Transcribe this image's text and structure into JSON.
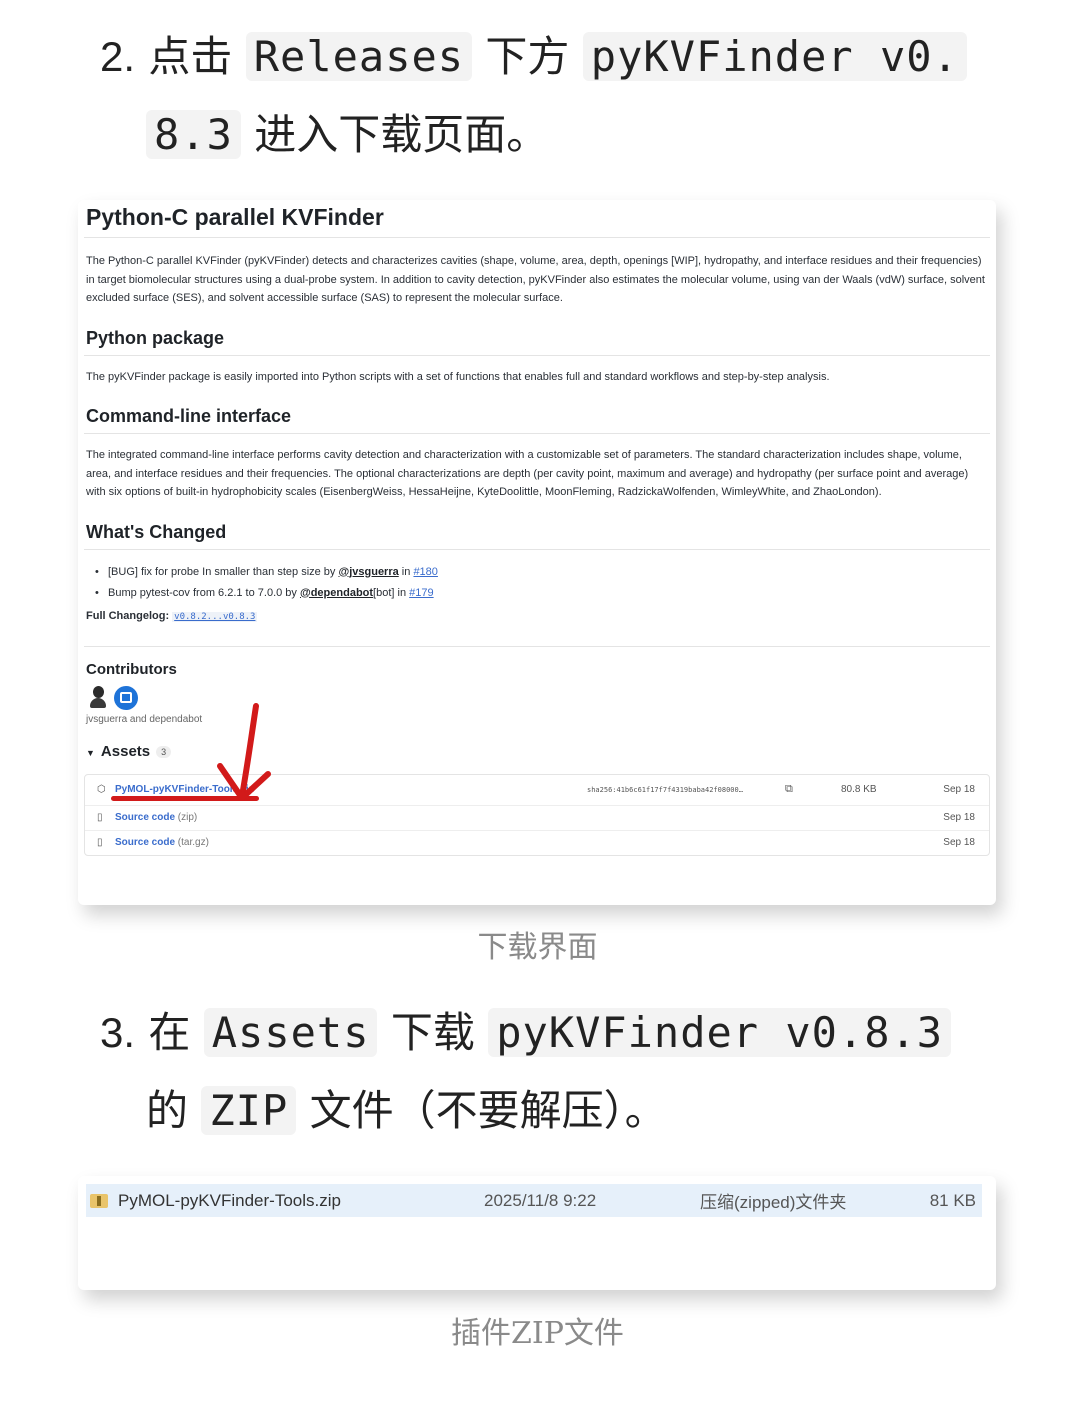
{
  "step2": {
    "number": "2.",
    "part1": "点击",
    "code1": "Releases",
    "part2": "下方",
    "code2a": "pyKVFinder v0.",
    "code2b": "8.3",
    "part3": "进入下载页面。"
  },
  "release": {
    "title": "Python-C parallel KVFinder",
    "intro": "The Python-C parallel KVFinder (pyKVFinder) detects and characterizes cavities (shape, volume, area, depth, openings [WIP], hydropathy, and interface residues and their frequencies) in target biomolecular structures using a dual-probe system. In addition to cavity detection, pyKVFinder also estimates the molecular volume, using van der Waals (vdW) surface, solvent excluded surface (SES), and solvent accessible surface (SAS) to represent the molecular surface.",
    "python_heading": "Python package",
    "python_text": "The pyKVFinder package is easily imported into Python scripts with a set of functions that enables full and standard workflows and step-by-step analysis.",
    "cli_heading": "Command-line interface",
    "cli_text": "The integrated command-line interface performs cavity detection and characterization with a customizable set of parameters. The standard characterization includes shape, volume, area, and interface residues and their frequencies. The optional characterizations are depth (per cavity point, maximum and average) and hydropathy (per surface point and average) with six options of built-in hydrophobicity scales (EisenbergWeiss, HessaHeijne, KyteDoolittle, MoonFleming, RadzickaWolfenden, WimleyWhite, and ZhaoLondon).",
    "changed_heading": "What's Changed",
    "changes": [
      {
        "text": "[BUG] fix for probe In smaller than step size by ",
        "user": "@jvsguerra",
        "in": " in ",
        "link": "#180",
        "suffix": ""
      },
      {
        "text": "Bump pytest-cov from 6.2.1 to 7.0.0 by ",
        "user": "@dependabot",
        "in": " in ",
        "link": "#179",
        "suffix": "[bot]"
      }
    ],
    "changelog_label": "Full Changelog:",
    "changelog_link": "v0.8.2...v0.8.3",
    "contributors_heading": "Contributors",
    "contributors_names": "jvsguerra and dependabot",
    "assets_label": "Assets",
    "assets_count": "3",
    "assets": [
      {
        "name": "PyMOL-pyKVFinder-Tools.zip",
        "sub": "",
        "sha": "sha256:41b6c61f17f7f4319baba42f08000…",
        "size": "80.8 KB",
        "date": "Sep 18"
      },
      {
        "name": "Source code",
        "sub": " (zip)",
        "sha": "",
        "size": "",
        "date": "Sep 18"
      },
      {
        "name": "Source code",
        "sub": " (tar.gz)",
        "sha": "",
        "size": "",
        "date": "Sep 18"
      }
    ],
    "annotation_color": "#d21a1a"
  },
  "caption1": "下载界面",
  "step3": {
    "number": "3.",
    "part1": "在",
    "code1": "Assets",
    "part2": "下载",
    "code2": "pyKVFinder v0.8.3",
    "part3": "的",
    "code3": "ZIP",
    "part4": "文件（不要解压）。"
  },
  "explorer": {
    "name": "PyMOL-pyKVFinder-Tools.zip",
    "date": "2025/11/8 9:22",
    "type": "压缩(zipped)文件夹",
    "size": "81 KB"
  },
  "caption2": "插件ZIP文件"
}
